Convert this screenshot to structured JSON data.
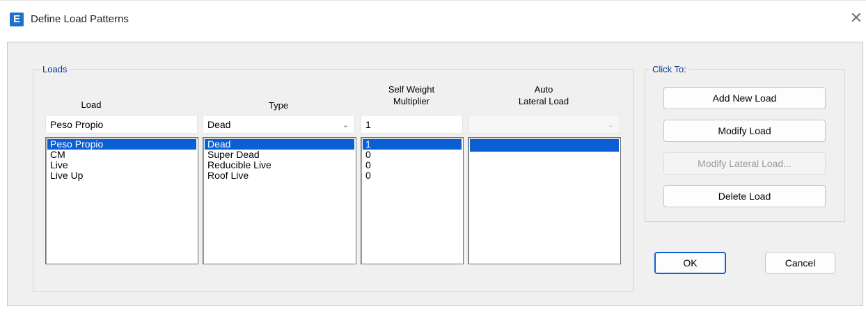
{
  "window": {
    "title": "Define Load Patterns",
    "app_icon_letter": "E",
    "close_glyph": "✕"
  },
  "loads_group": {
    "legend": "Loads"
  },
  "columns": {
    "load": "Load",
    "type": "Type",
    "self_weight_line1": "Self Weight",
    "self_weight_line2": "Multiplier",
    "auto_line1": "Auto",
    "auto_line2": "Lateral Load"
  },
  "inputs": {
    "load_name": "Peso Propio",
    "type_selected": "Dead",
    "multiplier": "1",
    "auto_lateral": ""
  },
  "lists": {
    "load": [
      "Peso Propio",
      "CM",
      "Live",
      "Live Up"
    ],
    "type": [
      "Dead",
      "Super Dead",
      "Reducible Live",
      "Roof Live"
    ],
    "multiplier": [
      "1",
      "0",
      "0",
      "0"
    ],
    "auto_lateral": [
      ""
    ]
  },
  "click_group": {
    "legend": "Click To:",
    "add_new": "Add New Load",
    "modify": "Modify Load",
    "modify_lateral": "Modify Lateral Load...",
    "delete": "Delete Load"
  },
  "footer": {
    "ok": "OK",
    "cancel": "Cancel"
  },
  "colors": {
    "accent": "#0a5fd4",
    "legend_text": "#0b3a8f",
    "icon_bg": "#1e73c9"
  }
}
